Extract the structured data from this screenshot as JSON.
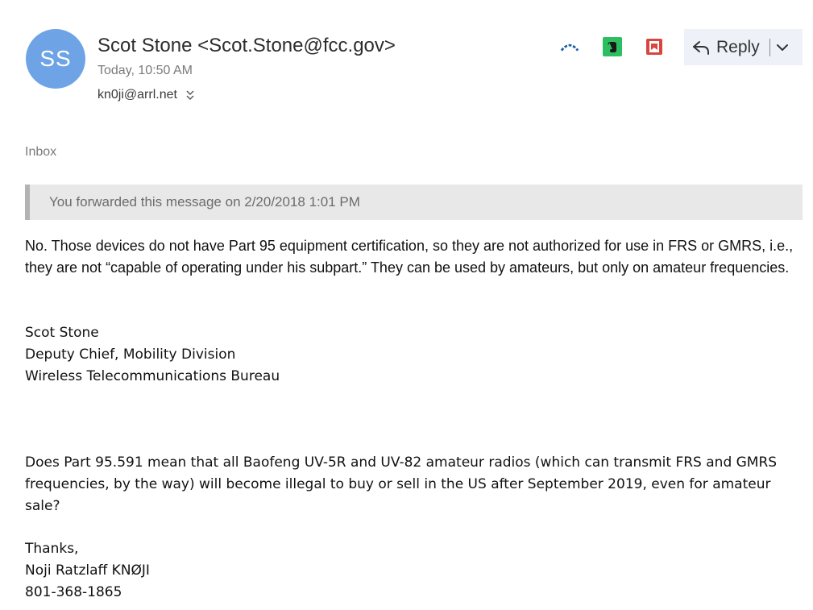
{
  "header": {
    "avatar_initials": "SS",
    "sender": "Scot Stone <Scot.Stone@fcc.gov>",
    "timestamp": "Today, 10:50 AM",
    "recipient": "kn0ji@arrl.net"
  },
  "toolbar": {
    "icons": [
      "link-share-icon",
      "evernote-icon",
      "office-lens-icon"
    ],
    "reply_label": "Reply",
    "colors": {
      "reply_bg": "#eef2f8",
      "evernote": "#2dbe60",
      "office_lens": "#d9463f",
      "share": "#1f5fa8"
    }
  },
  "folder": "Inbox",
  "forward_notice": "You forwarded this message on 2/20/2018 1:01 PM",
  "message": {
    "answer": "No.  Those devices do not have Part 95 equipment certification, so they are not authorized for use in FRS or GMRS, i.e., they are not “capable of operating under his subpart.”  They can be used by amateurs, but only on amateur frequencies.",
    "signature": {
      "name": "Scot Stone",
      "title": "Deputy Chief, Mobility Division",
      "bureau": "Wireless Telecommunications Bureau"
    },
    "question": "Does Part 95.591 mean that all Baofeng UV-5R and UV-82 amateur radios (which can transmit FRS and GMRS frequencies, by the way) will become illegal to buy or sell in the US after September 2019, even for amateur sale?",
    "closing": {
      "thanks": "Thanks,",
      "name": "Noji Ratzlaff KNØJI",
      "phone": "801-368-1865"
    }
  },
  "colors": {
    "avatar_bg": "#6ea4e6",
    "notice_bg": "#e8e8e8",
    "notice_bar": "#b3b3b3"
  }
}
